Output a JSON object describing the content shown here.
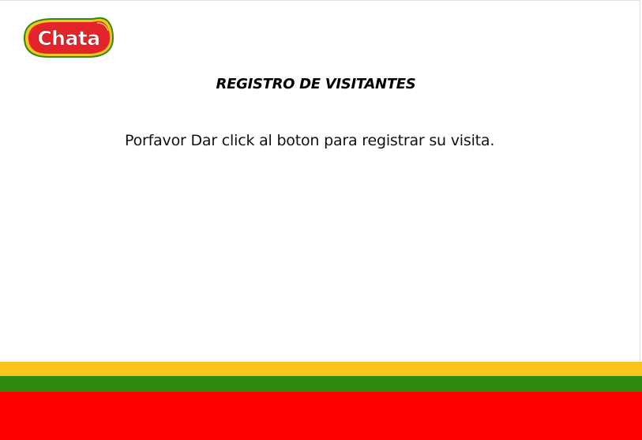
{
  "logo": {
    "text": "Chata"
  },
  "page": {
    "title": "REGISTRO DE VISITANTES",
    "message": "Porfavor Dar click al boton para registrar su visita."
  },
  "colors": {
    "brand_red": "#e3242b",
    "brand_yellow": "#f5c518",
    "brand_green": "#2f8a0f",
    "stripe_yellow": "#fbc31c",
    "stripe_green": "#2f8a0f",
    "stripe_red": "#ff0000"
  }
}
